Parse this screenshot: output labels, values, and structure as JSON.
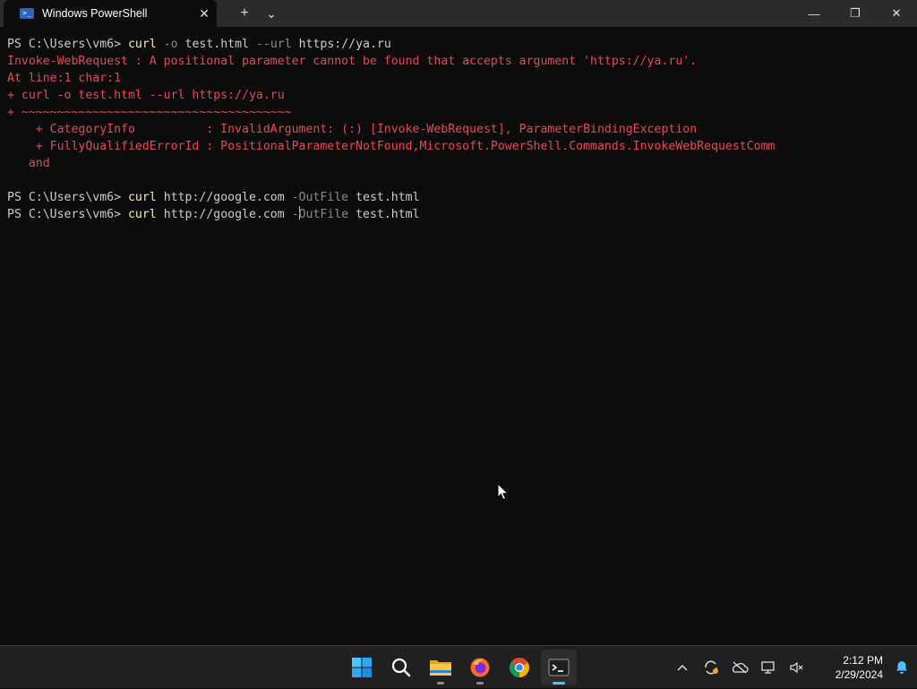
{
  "window": {
    "tab_title": "Windows PowerShell",
    "tab_icon_glyph": ">_",
    "new_tab_glyph": "+",
    "dropdown_glyph": "⌄",
    "close_tab_glyph": "✕",
    "minimize_glyph": "—",
    "maximize_glyph": "❐",
    "close_glyph": "✕"
  },
  "terminal": {
    "lines": [
      {
        "prompt": "PS C:\\Users\\vm6> ",
        "cmd": "curl",
        "parts": [
          " ",
          {
            "p": "-o"
          },
          " test.html ",
          {
            "p": "--url"
          },
          " https://ya.ru"
        ]
      },
      {
        "err": "Invoke-WebRequest : A positional parameter cannot be found that accepts argument 'https://ya.ru'."
      },
      {
        "err": "At line:1 char:1"
      },
      {
        "err": "+ curl -o test.html --url https://ya.ru"
      },
      {
        "err": "+ ~~~~~~~~~~~~~~~~~~~~~~~~~~~~~~~~~~~~~~"
      },
      {
        "err": "    + CategoryInfo          : InvalidArgument: (:) [Invoke-WebRequest], ParameterBindingException"
      },
      {
        "err": "    + FullyQualifiedErrorId : PositionalParameterNotFound,Microsoft.PowerShell.Commands.InvokeWebRequestComm"
      },
      {
        "err": "   and"
      },
      {
        "blank": true
      },
      {
        "prompt": "PS C:\\Users\\vm6> ",
        "cmd": "curl",
        "parts": [
          " http://google.com ",
          {
            "p": "-OutFile"
          },
          " test.html"
        ]
      },
      {
        "prompt": "PS C:\\Users\\vm6> ",
        "cmd": "curl",
        "parts": [
          " http://google.com ",
          {
            "p": "-",
            "cursor": true
          },
          {
            "p": "OutFile"
          },
          " test.html"
        ]
      }
    ]
  },
  "taskbar": {
    "apps": [
      "start",
      "search",
      "file-explorer",
      "firefox",
      "chrome",
      "terminal"
    ],
    "active_app": "terminal",
    "clock_time": "2:12 PM",
    "clock_date": "2/29/2024",
    "tray_chevron": "^"
  },
  "colors": {
    "background": "#0c0c0c",
    "command": "#f9f1a5",
    "parameter": "#8a8a8a",
    "error": "#e74856",
    "text": "#cccccc",
    "taskbar": "#202020"
  }
}
